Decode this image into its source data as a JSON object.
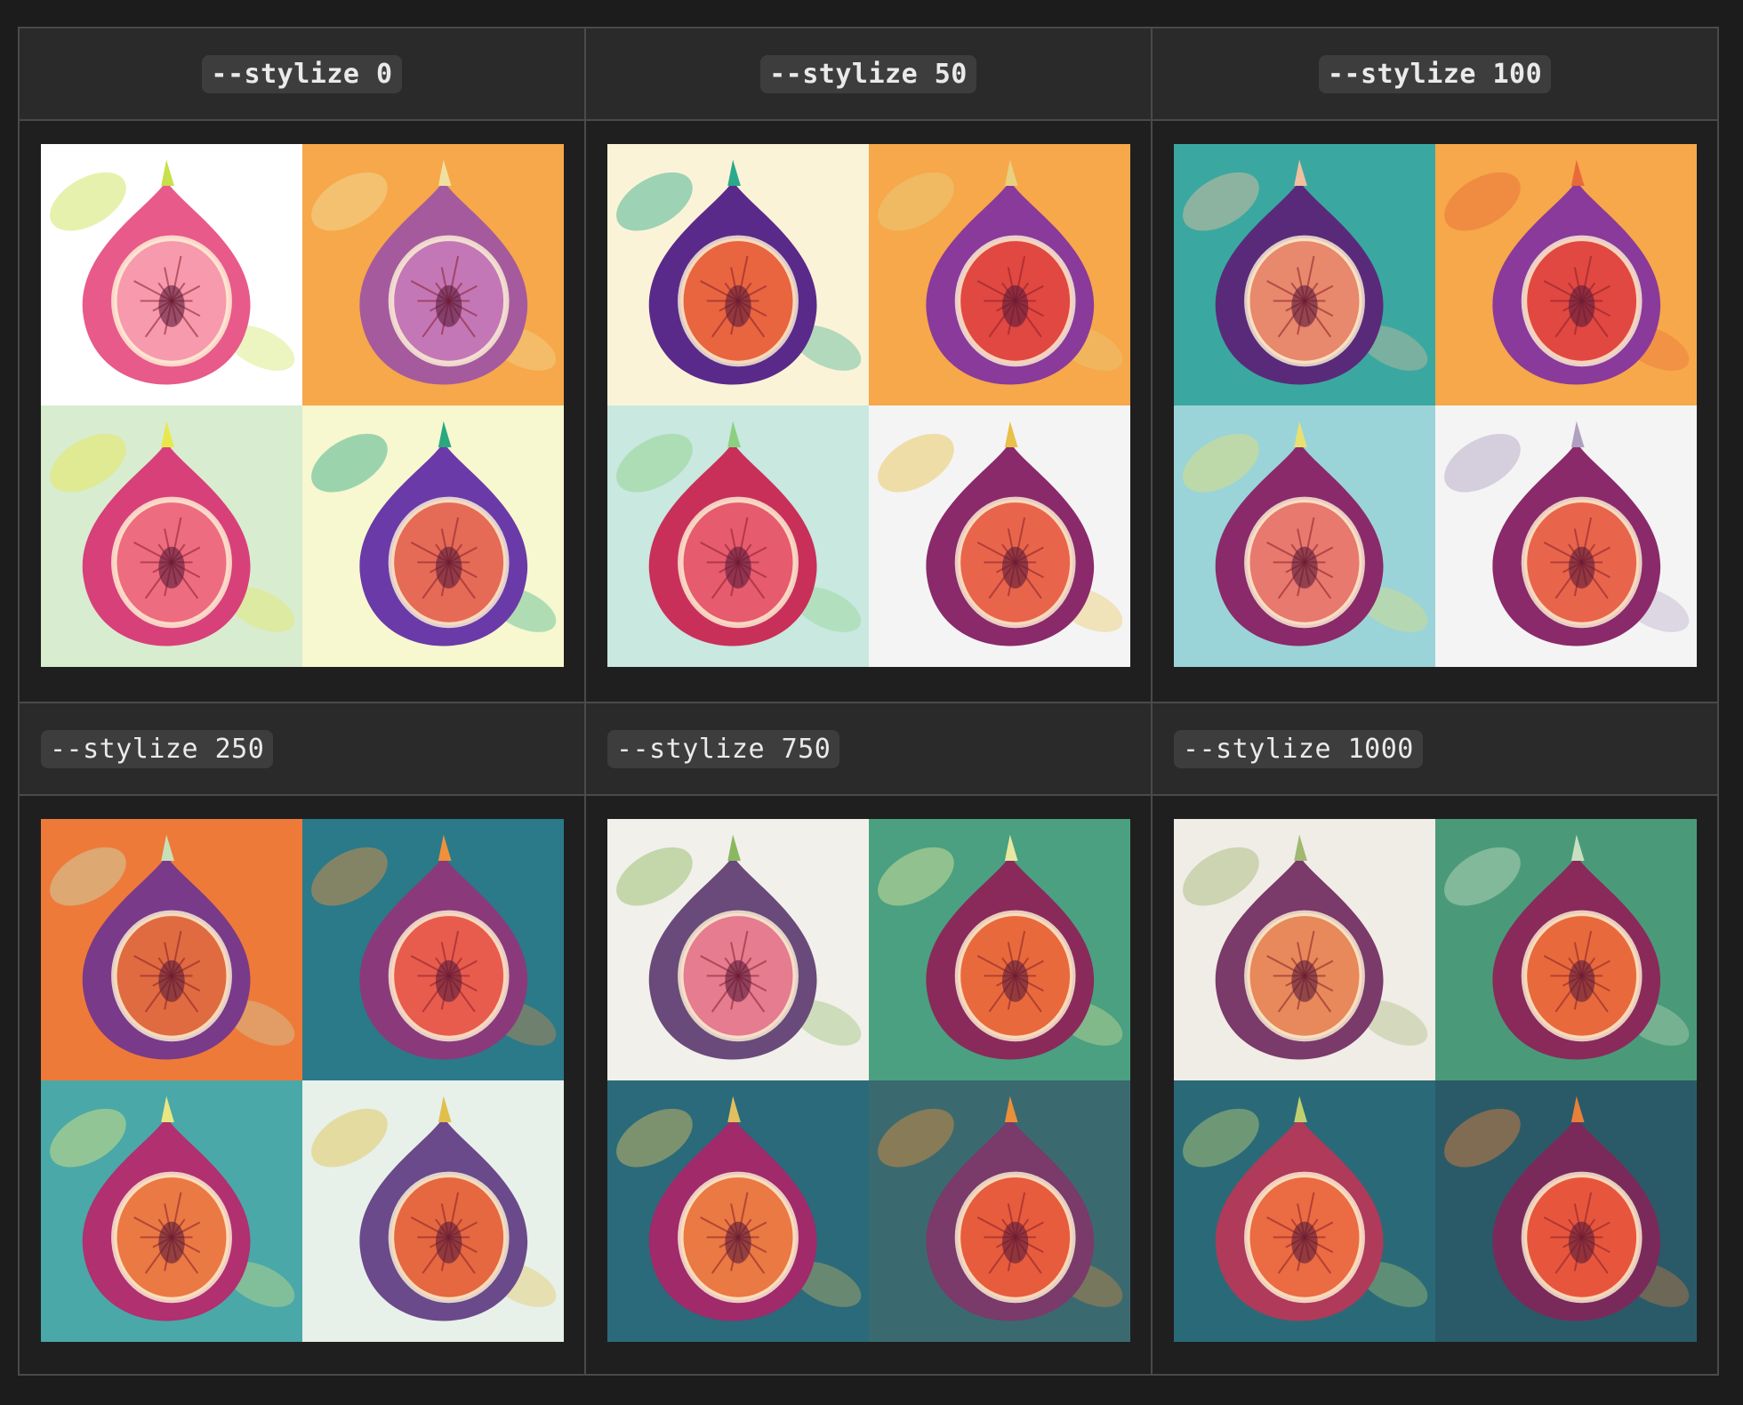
{
  "headers": [
    {
      "label": "--stylize 0"
    },
    {
      "label": "--stylize 50"
    },
    {
      "label": "--stylize 100"
    },
    {
      "label": "--stylize 250"
    },
    {
      "label": "--stylize 750"
    },
    {
      "label": "--stylize 1000"
    }
  ],
  "panels": [
    {
      "tiles": [
        {
          "bg": "#ffffff",
          "skin": "#e85a8a",
          "flesh": "#f7a0b0",
          "accent": "#c8e04a"
        },
        {
          "bg": "#f6a84a",
          "skin": "#a55a9e",
          "flesh": "#c77ab8",
          "accent": "#f0e0a0"
        },
        {
          "bg": "#d8ecd0",
          "skin": "#d8407a",
          "flesh": "#f07080",
          "accent": "#e8e84a"
        },
        {
          "bg": "#f7f7d0",
          "skin": "#6a3aa8",
          "flesh": "#f07050",
          "accent": "#2aa880"
        }
      ]
    },
    {
      "tiles": [
        {
          "bg": "#fbf3d8",
          "skin": "#5a2a8a",
          "flesh": "#f46a3a",
          "accent": "#2aaa8a"
        },
        {
          "bg": "#f6a84a",
          "skin": "#8a3a9a",
          "flesh": "#e84a3a",
          "accent": "#e8d080"
        },
        {
          "bg": "#c8e8e0",
          "skin": "#c8305a",
          "flesh": "#e86070",
          "accent": "#8ad080"
        },
        {
          "bg": "#f4f4f4",
          "skin": "#8a2a6a",
          "flesh": "#f06a4a",
          "accent": "#e8c04a"
        }
      ]
    },
    {
      "tiles": [
        {
          "bg": "#3aa8a0",
          "skin": "#5a2a7a",
          "flesh": "#f4906a",
          "accent": "#f0c0a0"
        },
        {
          "bg": "#f6a84a",
          "skin": "#8a3a9a",
          "flesh": "#e84a3a",
          "accent": "#e86a3a"
        },
        {
          "bg": "#9ad4d8",
          "skin": "#8a2a6a",
          "flesh": "#f08070",
          "accent": "#e8e070"
        },
        {
          "bg": "#f4f4f4",
          "skin": "#8a2a6a",
          "flesh": "#f06a4a",
          "accent": "#b0a0c0"
        }
      ]
    },
    {
      "tiles": [
        {
          "bg": "#ee7a3a",
          "skin": "#7a3a8a",
          "flesh": "#e8703a",
          "accent": "#c8e0b8"
        },
        {
          "bg": "#2a7a8a",
          "skin": "#8a3a7a",
          "flesh": "#f0604a",
          "accent": "#f0903a"
        },
        {
          "bg": "#4aa8a8",
          "skin": "#b03070",
          "flesh": "#f08040",
          "accent": "#e8e880"
        },
        {
          "bg": "#e8f0ea",
          "skin": "#6a4a8a",
          "flesh": "#f06a3a",
          "accent": "#e0c04a"
        }
      ]
    },
    {
      "tiles": [
        {
          "bg": "#f2f0ea",
          "skin": "#6a4a7a",
          "flesh": "#f08090",
          "accent": "#8ab860"
        },
        {
          "bg": "#4aa080",
          "skin": "#8a2a5a",
          "flesh": "#f0703a",
          "accent": "#e8e8a0"
        },
        {
          "bg": "#2a6a7a",
          "skin": "#a02a6a",
          "flesh": "#f08040",
          "accent": "#e0c060"
        },
        {
          "bg": "#3a6a70",
          "skin": "#7a3a6a",
          "flesh": "#f0603a",
          "accent": "#e8903a"
        }
      ]
    },
    {
      "tiles": [
        {
          "bg": "#f0ece6",
          "skin": "#7a3a6a",
          "flesh": "#f0905a",
          "accent": "#a0b870"
        },
        {
          "bg": "#4a9a7a",
          "skin": "#8a2a5a",
          "flesh": "#f0703a",
          "accent": "#c8e0c0"
        },
        {
          "bg": "#2a6a78",
          "skin": "#b03a5a",
          "flesh": "#f07040",
          "accent": "#c0d070"
        },
        {
          "bg": "#2a5a68",
          "skin": "#7a2a5a",
          "flesh": "#f05a3a",
          "accent": "#e8803a"
        }
      ]
    }
  ]
}
